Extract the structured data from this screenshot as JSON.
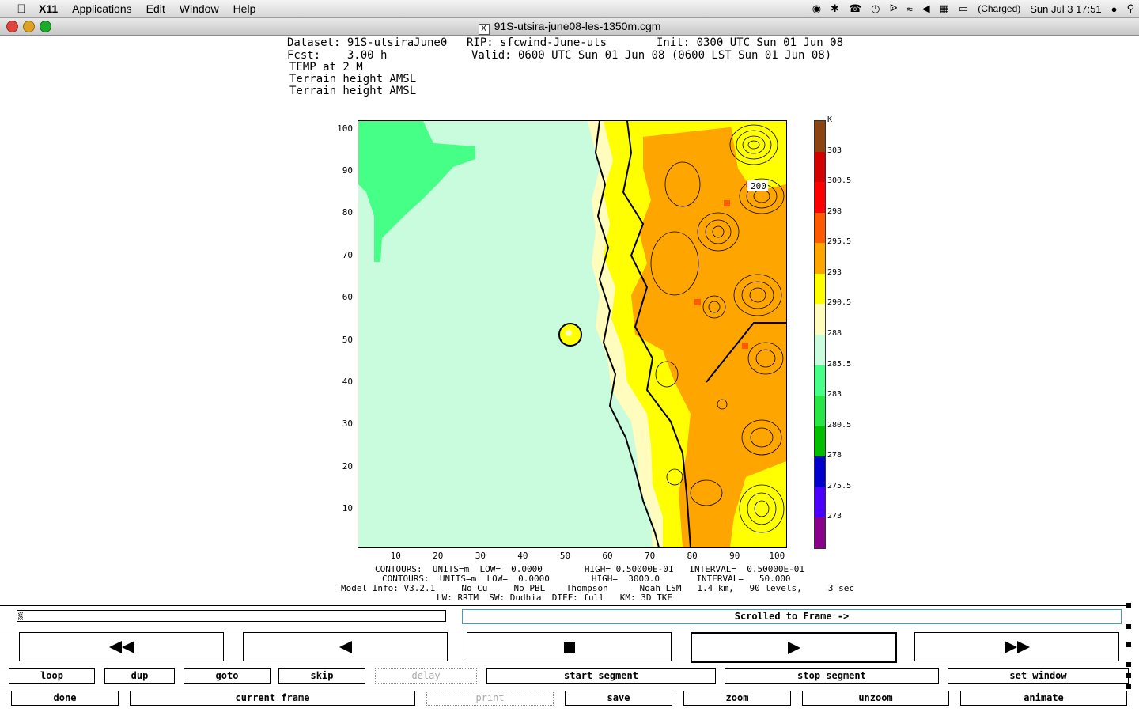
{
  "menubar": {
    "app": "X11",
    "items": [
      "Applications",
      "Edit",
      "Window",
      "Help"
    ],
    "battery": "(Charged)",
    "clock": "Sun Jul 3  17:51"
  },
  "window": {
    "title": "91S-utsira-june08-les-1350m.cgm"
  },
  "plot_header": {
    "line1a": "Dataset: 91S-utsiraJune0",
    "line1b": "RIP: sfcwind-June-uts",
    "line1c": "Init: 0300 UTC Sun 01 Jun 08",
    "line2a": "Fcst:    3.00 h",
    "line2b": "Valid: 0600 UTC Sun 01 Jun 08 (0600 LST Sun 01 Jun 08)",
    "line3": "TEMP at 2 M",
    "line4": "Terrain height AMSL",
    "line5": "Terrain height AMSL"
  },
  "chart_data": {
    "type": "heatmap",
    "xticks": [
      "10",
      "20",
      "30",
      "40",
      "50",
      "60",
      "70",
      "80",
      "90",
      "100"
    ],
    "yticks": [
      "100",
      "90",
      "80",
      "70",
      "60",
      "50",
      "40",
      "30",
      "20",
      "10"
    ],
    "xlim": [
      1,
      102
    ],
    "ylim": [
      1,
      102
    ],
    "contour_label": "200",
    "colorbar": {
      "unit": "K",
      "labels": [
        "303",
        "300.5",
        "298",
        "295.5",
        "293",
        "290.5",
        "288",
        "285.5",
        "283",
        "280.5",
        "278",
        "275.5",
        "273"
      ],
      "colors": [
        "#8b4513",
        "#d40000",
        "#ff0000",
        "#ff5a00",
        "#ffa500",
        "#ffff00",
        "#fffcbe",
        "#c8fcdc",
        "#46ff87",
        "#28e646",
        "#00be00",
        "#0000cd",
        "#4b00ff",
        "#8b008b"
      ]
    }
  },
  "footer": {
    "line1": "CONTOURS:  UNITS=m  LOW=  0.0000        HIGH= 0.50000E-01   INTERVAL=  0.50000E-01",
    "line2": "CONTOURS:  UNITS=m  LOW=  0.0000        HIGH=  3000.0       INTERVAL=   50.000",
    "line3": "Model Info: V3.2.1     No Cu     No PBL    Thompson      Noah LSM   1.4 km,   90 levels,     3 sec",
    "line4": "LW: RRTM  SW: Dudhia  DIFF: full   KM: 3D TKE"
  },
  "controls": {
    "frame_label": "Scrolled to Frame ->",
    "row1": [
      "loop",
      "dup",
      "goto",
      "skip",
      "delay",
      "start segment",
      "stop segment",
      "set window"
    ],
    "row2": [
      "done",
      "current frame",
      "print",
      "save",
      "zoom",
      "unzoom",
      "animate"
    ]
  }
}
